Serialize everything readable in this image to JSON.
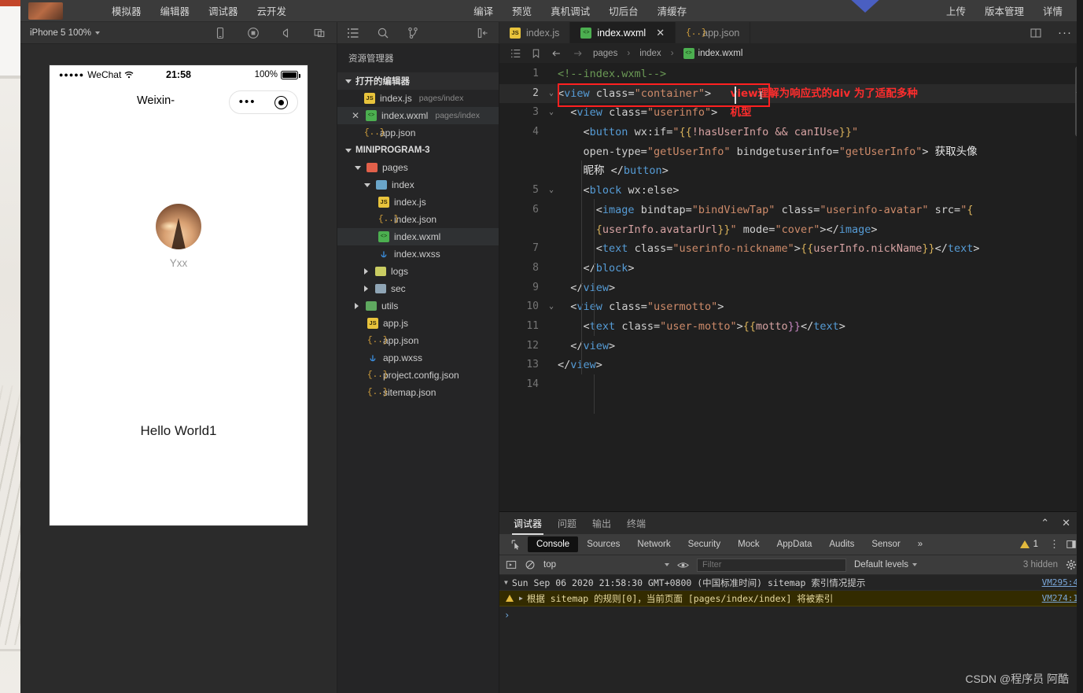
{
  "topbar": {
    "left_menu": [
      "模拟器",
      "编辑器",
      "调试器",
      "云开发"
    ],
    "center_menu": [
      "编译",
      "预览",
      "真机调试",
      "切后台",
      "清缓存"
    ],
    "right_menu": [
      "上传",
      "版本管理",
      "详情"
    ]
  },
  "simulator_toolbar": {
    "device": "iPhone 5 100%",
    "icons": [
      "phone-icon",
      "record-icon",
      "volume-icon",
      "multi-window-icon"
    ]
  },
  "explorer_toolbar": {
    "icons": [
      "file-list-icon",
      "search-icon",
      "source-control-icon",
      "collapse-panel-icon"
    ]
  },
  "tabs": [
    {
      "label": "index.js",
      "icon": "js-file-icon",
      "active": false,
      "closable": false
    },
    {
      "label": "index.wxml",
      "icon": "wxml-file-icon",
      "active": true,
      "closable": true
    },
    {
      "label": "app.json",
      "icon": "json-file-icon",
      "active": false,
      "closable": false
    }
  ],
  "tab_actions": [
    "split-editor-icon",
    "more-actions-icon"
  ],
  "simulator": {
    "status_bar": {
      "carrier": "WeChat",
      "signal_dots": "●●●●●",
      "wifi": "wifi-icon",
      "time": "21:58",
      "battery_percent": "100%"
    },
    "nav_title": "Weixin-",
    "capsule": {
      "menu": "more-icon",
      "target": "target-icon"
    },
    "nickname": "Yxx",
    "motto": "Hello World1",
    "avatar_alt": "eiffel-tower-sunset-avatar"
  },
  "explorer": {
    "title": "资源管理器",
    "open_editors": {
      "label": "打开的编辑器",
      "items": [
        {
          "name": "index.js",
          "path": "pages/index",
          "icon": "js-file-icon",
          "selected": false,
          "closable": false
        },
        {
          "name": "index.wxml",
          "path": "pages/index",
          "icon": "wxml-file-icon",
          "selected": true,
          "closable": true
        },
        {
          "name": "app.json",
          "path": "",
          "icon": "json-file-icon",
          "selected": false,
          "closable": false
        }
      ]
    },
    "project": {
      "label": "MINIPROGRAM-3",
      "items": [
        {
          "name": "pages",
          "type": "folder",
          "icon": "folder-pages",
          "indent": 1,
          "expanded": true
        },
        {
          "name": "index",
          "type": "folder",
          "icon": "folder-index",
          "indent": 2,
          "expanded": true
        },
        {
          "name": "index.js",
          "type": "file",
          "icon": "js-file-icon",
          "indent": 3,
          "selected": false
        },
        {
          "name": "index.json",
          "type": "file",
          "icon": "json-file-icon",
          "indent": 3,
          "selected": false
        },
        {
          "name": "index.wxml",
          "type": "file",
          "icon": "wxml-file-icon",
          "indent": 3,
          "selected": true
        },
        {
          "name": "index.wxss",
          "type": "file",
          "icon": "wxss-file-icon",
          "indent": 3,
          "selected": false
        },
        {
          "name": "logs",
          "type": "folder",
          "icon": "folder-logs",
          "indent": 2,
          "expanded": false
        },
        {
          "name": "sec",
          "type": "folder",
          "icon": "folder-sec",
          "indent": 2,
          "expanded": false
        },
        {
          "name": "utils",
          "type": "folder",
          "icon": "folder-utils",
          "indent": 1,
          "expanded": false
        },
        {
          "name": "app.js",
          "type": "file",
          "icon": "js-file-icon",
          "indent": 1,
          "selected": false
        },
        {
          "name": "app.json",
          "type": "file",
          "icon": "json-file-icon",
          "indent": 1,
          "selected": false
        },
        {
          "name": "app.wxss",
          "type": "file",
          "icon": "wxss-file-icon",
          "indent": 1,
          "selected": false
        },
        {
          "name": "project.config.json",
          "type": "file",
          "icon": "json-file-icon",
          "indent": 1,
          "selected": false
        },
        {
          "name": "sitemap.json",
          "type": "file",
          "icon": "json-file-icon",
          "indent": 1,
          "selected": false
        }
      ]
    }
  },
  "breadcrumb": {
    "icons": [
      "outline-icon",
      "bookmark-icon",
      "back-arrow-icon",
      "forward-arrow-icon"
    ],
    "parts": [
      "pages",
      "index"
    ],
    "file": "index.wxml"
  },
  "editor": {
    "filename": "index.wxml",
    "annotation_1": "view理解为响应式的div 为了适配多种",
    "annotation_2": "机型",
    "line_count": 14,
    "current_line": 2,
    "lines": [
      {
        "n": "1",
        "fold": "",
        "text": "  <!--index.wxml-->"
      },
      {
        "n": "2",
        "fold": "v",
        "text": "  <view class=\"container\">"
      },
      {
        "n": "3",
        "fold": "v",
        "text": "    <view class=\"userinfo\">"
      },
      {
        "n": "4",
        "fold": "",
        "text": "      <button wx:if=\"{{!hasUserInfo && canIUse}}\""
      },
      {
        "n": "",
        "fold": "",
        "text": "      open-type=\"getUserInfo\" bindgetuserinfo=\"getUserInfo\"> 获取头像"
      },
      {
        "n": "",
        "fold": "",
        "text": "      昵称 </button>"
      },
      {
        "n": "5",
        "fold": "v",
        "text": "      <block wx:else>"
      },
      {
        "n": "6",
        "fold": "",
        "text": "        <image bindtap=\"bindViewTap\" class=\"userinfo-avatar\" src=\"{"
      },
      {
        "n": "",
        "fold": "",
        "text": "        {userInfo.avatarUrl}}\" mode=\"cover\"></image>"
      },
      {
        "n": "7",
        "fold": "",
        "text": "        <text class=\"userinfo-nickname\">{{userInfo.nickName}}</text>"
      },
      {
        "n": "8",
        "fold": "",
        "text": "      </block>"
      },
      {
        "n": "9",
        "fold": "",
        "text": "    </view>"
      },
      {
        "n": "10",
        "fold": "v",
        "text": "    <view class=\"usermotto\">"
      },
      {
        "n": "11",
        "fold": "",
        "text": "      <text class=\"user-motto\">{{motto}}</text>"
      },
      {
        "n": "12",
        "fold": "",
        "text": "    </view>"
      },
      {
        "n": "13",
        "fold": "",
        "text": "  </view>"
      },
      {
        "n": "14",
        "fold": "",
        "text": ""
      }
    ]
  },
  "devtools": {
    "tabs": [
      "调试器",
      "问题",
      "输出",
      "终端"
    ],
    "active_tab": "调试器",
    "panel_actions": [
      "collapse-icon",
      "close-icon"
    ],
    "subtabs": [
      "Console",
      "Sources",
      "Network",
      "Security",
      "Mock",
      "AppData",
      "Audits",
      "Sensor"
    ],
    "active_subtab": "Console",
    "more_subtabs": "»",
    "warning_count": "1",
    "subtab_actions": [
      "inspect-element-icon",
      "more-options-icon",
      "dock-side-icon"
    ],
    "filterbar": {
      "execute_icon": "execute-icon",
      "clear_icon": "clear-console-icon",
      "context": "top",
      "eye_icon": "live-expression-icon",
      "filter_placeholder": "Filter",
      "levels": "Default levels",
      "hidden": "3 hidden",
      "settings_icon": "settings-gear-icon"
    },
    "logs": [
      {
        "type": "info",
        "text": "Sun Sep 06 2020 21:58:30 GMT+0800 (中国标准时间) sitemap 索引情况提示",
        "source": "VM295:4"
      },
      {
        "type": "warning",
        "text": "根据 sitemap 的规则[0]，当前页面 [pages/index/index] 将被索引",
        "source": "VM274:1"
      }
    ],
    "prompt": "›"
  },
  "watermark": "CSDN @程序员 阿酷"
}
